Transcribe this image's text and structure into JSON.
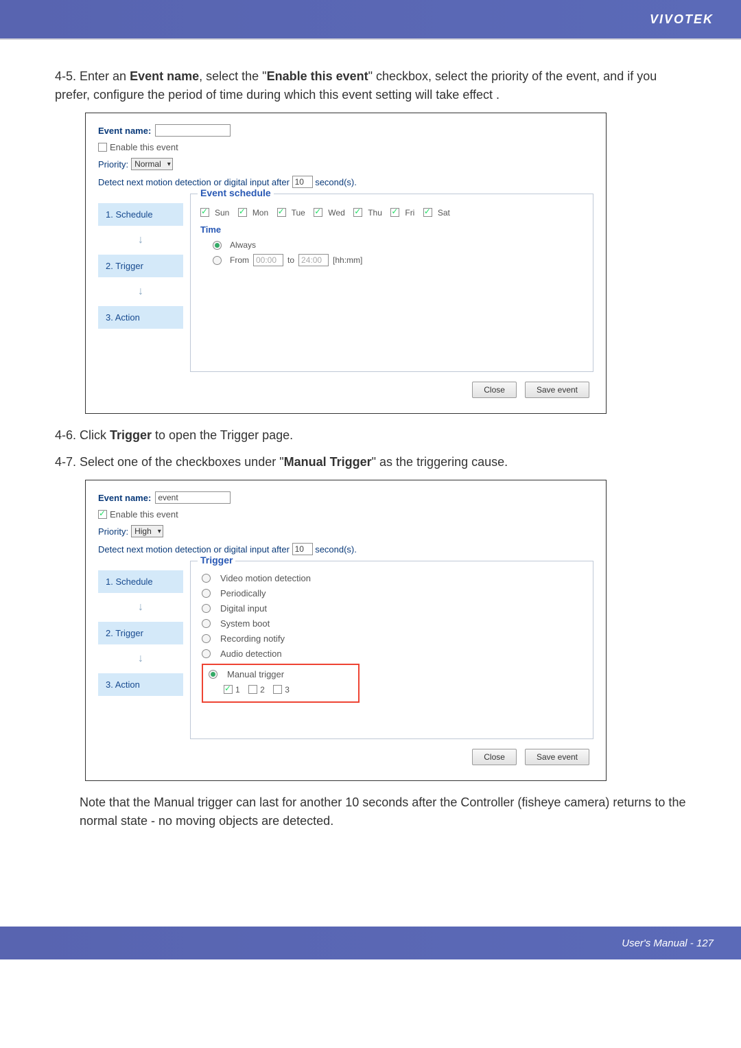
{
  "brand": "VIVOTEK",
  "instructions": {
    "i45": "4-5. Enter an ",
    "i45_b1": "Event name",
    "i45_m": ", select the \"",
    "i45_b2": "Enable this event",
    "i45_e": "\" checkbox, select the priority of the event, and if you prefer, configure the period of time during which this event setting will take effect .",
    "i46": "4-6. Click ",
    "i46_b": "Trigger",
    "i46_e": " to open the Trigger page.",
    "i47": "4-7. Select one of the checkboxes under \"",
    "i47_b": "Manual Trigger",
    "i47_e": "\" as the triggering cause."
  },
  "panel1": {
    "eventNameLabel": "Event name:",
    "eventNameValue": "",
    "enableLabel": "Enable this event",
    "enableChecked": false,
    "priorityLabel": "Priority:",
    "priorityValue": "Normal",
    "detectPrefix": "Detect next motion detection or digital input after",
    "detectValue": "10",
    "detectSuffix": "second(s).",
    "steps": [
      "1.  Schedule",
      "2.  Trigger",
      "3.  Action"
    ],
    "legend": "Event schedule",
    "days": [
      "Sun",
      "Mon",
      "Tue",
      "Wed",
      "Thu",
      "Fri",
      "Sat"
    ],
    "timeLabel": "Time",
    "always": "Always",
    "fromLabel": "From",
    "fromValue": "00:00",
    "toLabel": "to",
    "toValue": "24:00",
    "hhmm": "[hh:mm]",
    "closeBtn": "Close",
    "saveBtn": "Save event"
  },
  "panel2": {
    "eventNameLabel": "Event name:",
    "eventNameValue": "event",
    "enableLabel": "Enable this event",
    "enableChecked": true,
    "priorityLabel": "Priority:",
    "priorityValue": "High",
    "detectPrefix": "Detect next motion detection or digital input after",
    "detectValue": "10",
    "detectSuffix": "second(s).",
    "steps": [
      "1.  Schedule",
      "2.  Trigger",
      "3.  Action"
    ],
    "legend": "Trigger",
    "triggers": {
      "video": "Video motion detection",
      "periodically": "Periodically",
      "digital": "Digital input",
      "boot": "System boot",
      "recording": "Recording notify",
      "audio": "Audio detection",
      "manual": "Manual trigger"
    },
    "manual_opts": [
      "1",
      "2",
      "3"
    ],
    "closeBtn": "Close",
    "saveBtn": "Save event"
  },
  "note": "Note that the Manual trigger can last for another 10 seconds after the Controller (fisheye camera) returns to the normal state - no moving objects are detected.",
  "footer": "User's Manual - 127"
}
